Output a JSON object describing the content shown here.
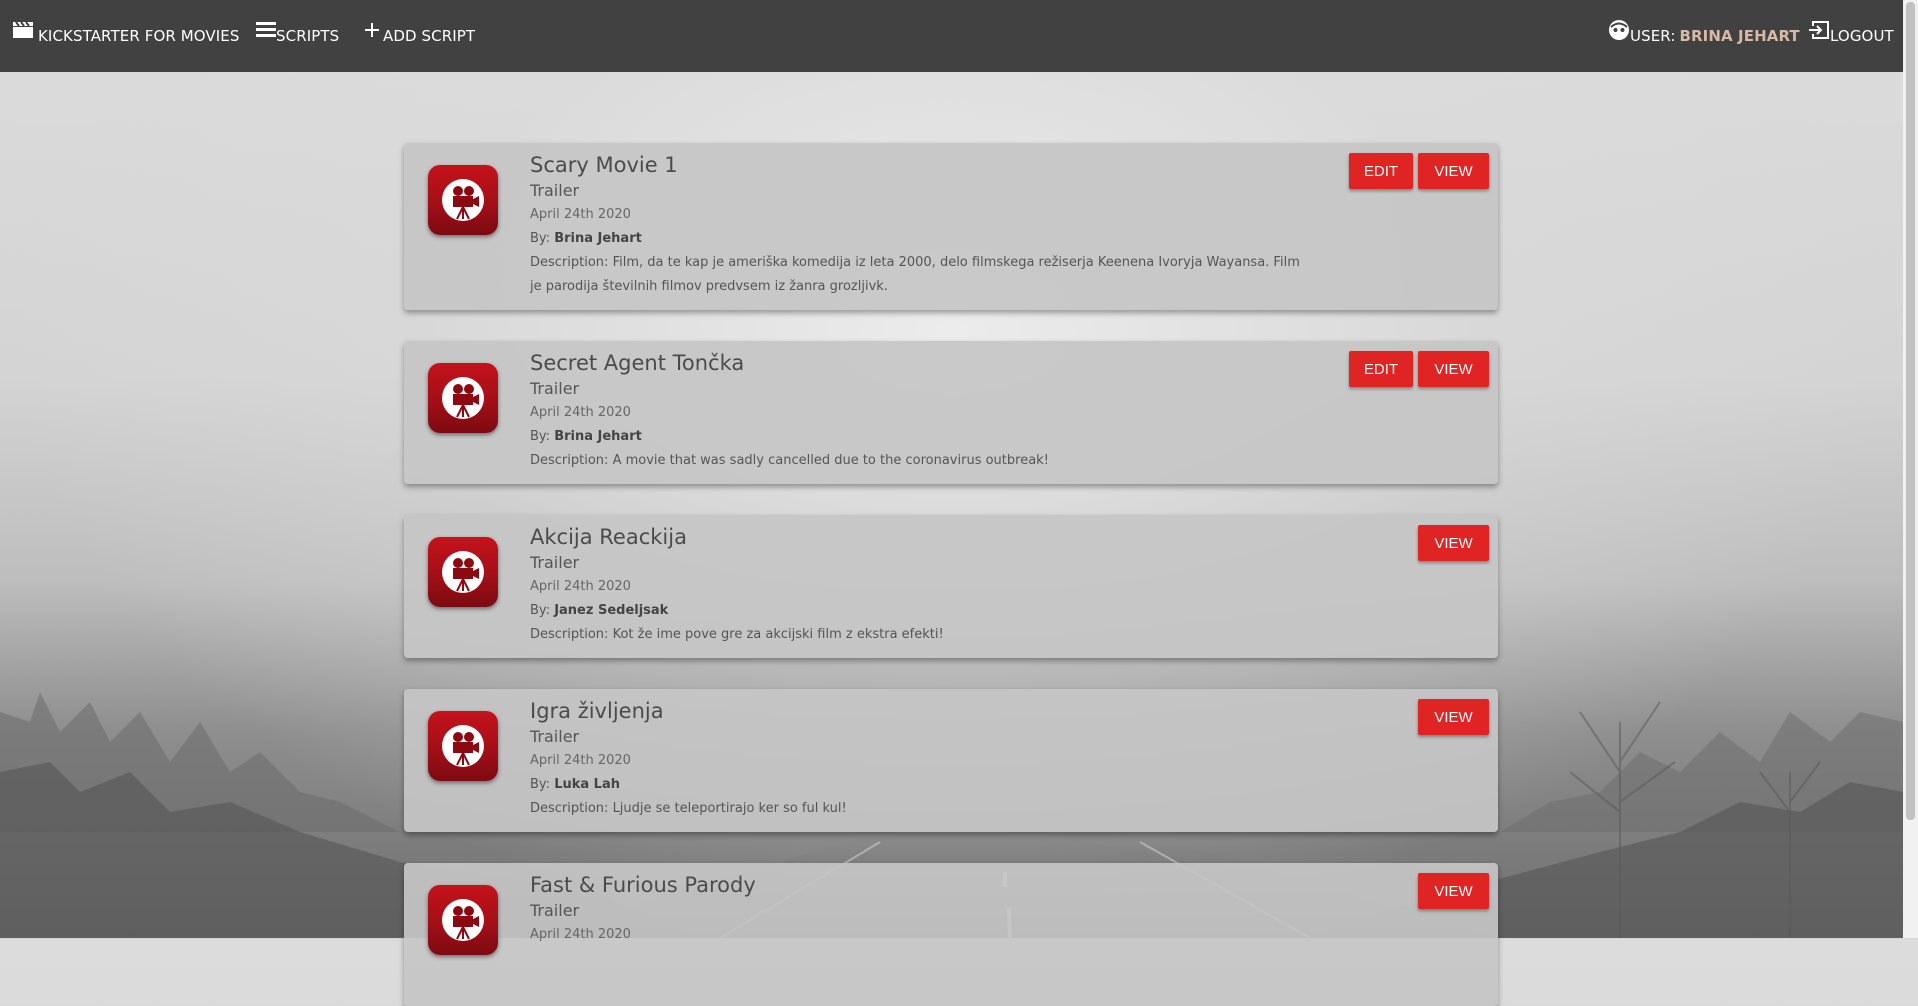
{
  "navbar": {
    "brand": "KICKSTARTER FOR MOVIES",
    "scripts": "SCRIPTS",
    "add_script": "ADD SCRIPT",
    "user_label": "USER:",
    "user_name": "BRINA JEHART",
    "logout": "LOGOUT"
  },
  "labels": {
    "edit": "EDIT",
    "view": "VIEW",
    "by": "By:",
    "description": "Description:"
  },
  "colors": {
    "navbar": "#414141",
    "accent_button": "#e02424",
    "user_name": "#d9b8a6",
    "card": "#c6c6c6"
  },
  "scripts": [
    {
      "title": "Scary Movie 1",
      "type": "Trailer",
      "date": "April 24th 2020",
      "author": "Brina Jehart",
      "description": "Film, da te kap je ameriška komedija iz leta 2000, delo filmskega režiserja Keenena Ivoryja Wayansa. Film je parodija številnih filmov predvsem iz žanra grozljivk.",
      "can_edit": true
    },
    {
      "title": "Secret Agent Tončka",
      "type": "Trailer",
      "date": "April 24th 2020",
      "author": "Brina Jehart",
      "description": "A movie that was sadly cancelled due to the coronavirus outbreak!",
      "can_edit": true
    },
    {
      "title": "Akcija Reackija",
      "type": "Trailer",
      "date": "April 24th 2020",
      "author": "Janez Sedeljsak",
      "description": "Kot že ime pove gre za akcijski film z ekstra efekti!",
      "can_edit": false
    },
    {
      "title": "Igra življenja",
      "type": "Trailer",
      "date": "April 24th 2020",
      "author": "Luka Lah",
      "description": "Ljudje se teleportirajo ker so ful kul!",
      "can_edit": false
    },
    {
      "title": "Fast & Furious Parody",
      "type": "Trailer",
      "date": "April 24th 2020",
      "author": "",
      "description": "",
      "can_edit": false
    }
  ]
}
